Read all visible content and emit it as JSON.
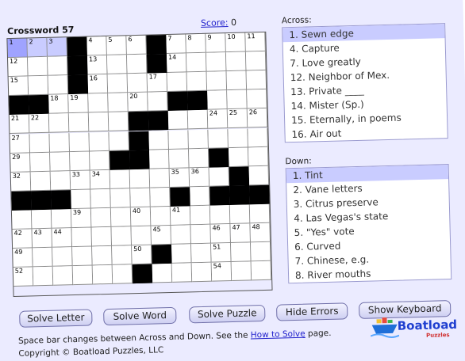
{
  "title": "Crossword 57",
  "score": {
    "label": "Score:",
    "value": "0"
  },
  "grid": {
    "rows": [
      "...#...#.....",
      "...#...#.....",
      "...#.........",
      "##......##...",
      "......##.....",
      "......#......",
      ".....##...#..",
      "...........#.",
      "###.....#.###",
      "............",
      ".............",
      ".......#.....",
      "......#......"
    ],
    "numbers": [
      [
        0,
        0,
        "1"
      ],
      [
        0,
        1,
        "2"
      ],
      [
        0,
        2,
        "3"
      ],
      [
        0,
        4,
        "4"
      ],
      [
        0,
        5,
        "5"
      ],
      [
        0,
        6,
        "6"
      ],
      [
        0,
        8,
        "7"
      ],
      [
        0,
        9,
        "8"
      ],
      [
        0,
        10,
        "9"
      ],
      [
        0,
        11,
        "10"
      ],
      [
        0,
        12,
        "11"
      ],
      [
        1,
        0,
        "12"
      ],
      [
        1,
        4,
        "13"
      ],
      [
        1,
        8,
        "14"
      ],
      [
        2,
        0,
        "15"
      ],
      [
        2,
        4,
        "16"
      ],
      [
        2,
        7,
        "17"
      ],
      [
        3,
        2,
        "18"
      ],
      [
        3,
        3,
        "19"
      ],
      [
        3,
        6,
        "20"
      ],
      [
        4,
        0,
        "21"
      ],
      [
        4,
        1,
        "22"
      ],
      [
        4,
        7,
        "23"
      ],
      [
        4,
        10,
        "24"
      ],
      [
        4,
        11,
        "25"
      ],
      [
        4,
        12,
        "26"
      ],
      [
        5,
        0,
        "27"
      ],
      [
        5,
        6,
        "28"
      ],
      [
        6,
        0,
        "29"
      ],
      [
        6,
        5,
        "30"
      ],
      [
        6,
        10,
        "31"
      ],
      [
        7,
        0,
        "32"
      ],
      [
        7,
        3,
        "33"
      ],
      [
        7,
        4,
        "34"
      ],
      [
        7,
        8,
        "35"
      ],
      [
        7,
        9,
        "36"
      ],
      [
        8,
        0,
        "37"
      ],
      [
        8,
        8,
        "38"
      ],
      [
        9,
        3,
        "39"
      ],
      [
        9,
        6,
        "40"
      ],
      [
        9,
        8,
        "41"
      ],
      [
        10,
        0,
        "42"
      ],
      [
        10,
        1,
        "43"
      ],
      [
        10,
        2,
        "44"
      ],
      [
        10,
        7,
        "45"
      ],
      [
        10,
        10,
        "46"
      ],
      [
        10,
        11,
        "47"
      ],
      [
        10,
        12,
        "48"
      ],
      [
        11,
        0,
        "49"
      ],
      [
        11,
        6,
        "50"
      ],
      [
        11,
        10,
        "51"
      ],
      [
        12,
        0,
        "52"
      ],
      [
        12,
        6,
        "53"
      ],
      [
        12,
        10,
        "54"
      ]
    ]
  },
  "across": {
    "header": "Across:",
    "clues": [
      "1. Sewn edge",
      "4. Capture",
      "7. Love greatly",
      "12. Neighbor of Mex.",
      "13. Private ____",
      "14. Mister (Sp.)",
      "15. Eternally, in poems",
      "16. Air out"
    ]
  },
  "down": {
    "header": "Down:",
    "clues": [
      "1. Tint",
      "2. Vane letters",
      "3. Citrus preserve",
      "4. Las Vegas's state",
      "5. \"Yes\" vote",
      "6. Curved",
      "7. Chinese, e.g.",
      "8. River mouths"
    ]
  },
  "buttons": {
    "solve_letter": "Solve Letter",
    "solve_word": "Solve Word",
    "solve_puzzle": "Solve Puzzle",
    "hide_errors": "Hide Errors",
    "show_keyboard": "Show Keyboard"
  },
  "info": {
    "line1_prefix": "Space bar changes between Across and Down. See the ",
    "line1_link": "How to Solve",
    "line1_suffix": " page.",
    "line2": "Copyright © Boatload Puzzles, LLC"
  },
  "logo": {
    "text": "Boatload",
    "sub": "Puzzles"
  },
  "colors": {
    "panel": "#ebebff",
    "selected_cell": "#9fa3ff",
    "highlight": "#c9ccff",
    "link": "#2222cc"
  }
}
